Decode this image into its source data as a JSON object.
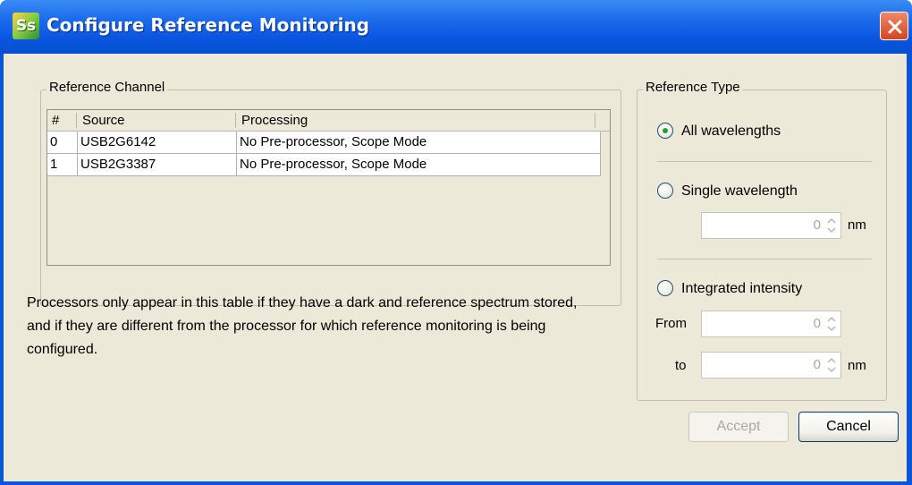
{
  "window": {
    "title": "Configure Reference Monitoring",
    "app_icon_text": "Ss"
  },
  "reference_channel": {
    "group_label": "Reference Channel",
    "columns": [
      "#",
      "Source",
      "Processing"
    ],
    "rows": [
      {
        "num": "0",
        "source": "USB2G6142",
        "processing": "No Pre-processor, Scope Mode"
      },
      {
        "num": "1",
        "source": "USB2G3387",
        "processing": "No Pre-processor, Scope Mode"
      }
    ]
  },
  "note": "Processors only appear in this table if they have a dark and reference spectrum stored, and if they are different from the processor for which reference monitoring is being configured.",
  "reference_type": {
    "group_label": "Reference Type",
    "options": [
      {
        "label": "All wavelengths",
        "selected": true
      },
      {
        "label": "Single wavelength",
        "selected": false
      },
      {
        "label": "Integrated intensity",
        "selected": false
      }
    ],
    "single_value": "0",
    "single_unit": "nm",
    "from_label": "From",
    "from_value": "0",
    "to_label": "to",
    "to_value": "0",
    "to_unit": "nm"
  },
  "buttons": {
    "accept": "Accept",
    "cancel": "Cancel"
  },
  "colors": {
    "titlebar": "#0a56e2",
    "dialog_bg": "#ece9d8",
    "radio_selected": "#21a121",
    "close_button": "#d2441f"
  }
}
